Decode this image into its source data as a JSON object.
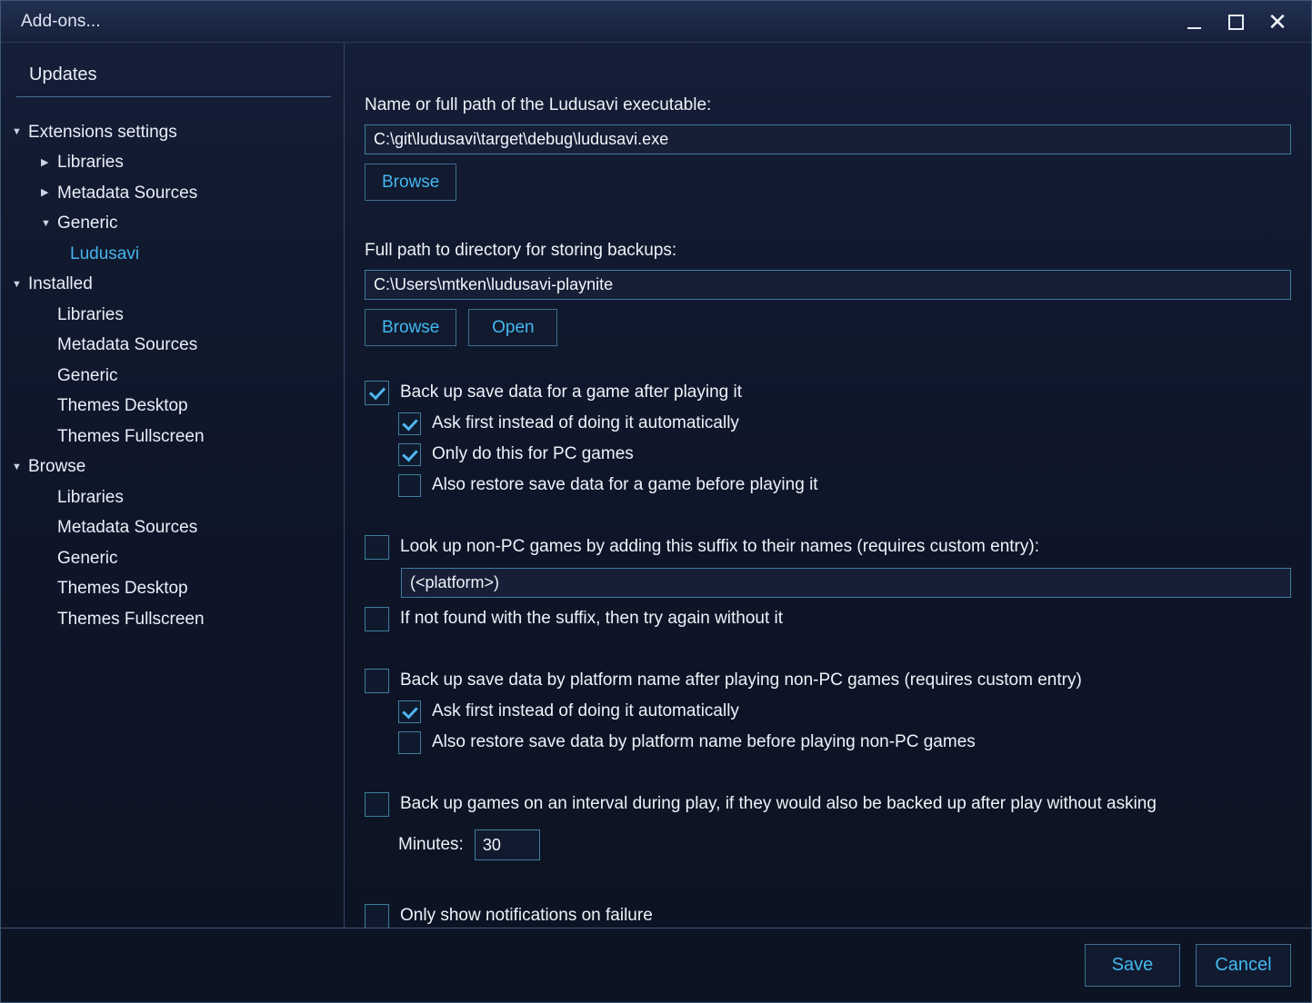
{
  "window": {
    "title": "Add-ons...",
    "minimize_icon": "minimize-icon",
    "maximize_icon": "maximize-icon",
    "close_icon": "close-icon"
  },
  "sidebar": {
    "updates_label": "Updates",
    "tree": [
      {
        "label": "Extensions settings",
        "level": 0,
        "marker": "▼",
        "selected": false
      },
      {
        "label": "Libraries",
        "level": 1,
        "marker": "▶",
        "selected": false
      },
      {
        "label": "Metadata Sources",
        "level": 1,
        "marker": "▶",
        "selected": false
      },
      {
        "label": "Generic",
        "level": 1,
        "marker": "▼",
        "selected": false
      },
      {
        "label": "Ludusavi",
        "level": 2,
        "marker": "",
        "selected": true
      },
      {
        "label": "Installed",
        "level": 0,
        "marker": "▼",
        "selected": false
      },
      {
        "label": "Libraries",
        "level": 1,
        "marker": "",
        "selected": false
      },
      {
        "label": "Metadata Sources",
        "level": 1,
        "marker": "",
        "selected": false
      },
      {
        "label": "Generic",
        "level": 1,
        "marker": "",
        "selected": false
      },
      {
        "label": "Themes Desktop",
        "level": 1,
        "marker": "",
        "selected": false
      },
      {
        "label": "Themes Fullscreen",
        "level": 1,
        "marker": "",
        "selected": false
      },
      {
        "label": "Browse",
        "level": 0,
        "marker": "▼",
        "selected": false
      },
      {
        "label": "Libraries",
        "level": 1,
        "marker": "",
        "selected": false
      },
      {
        "label": "Metadata Sources",
        "level": 1,
        "marker": "",
        "selected": false
      },
      {
        "label": "Generic",
        "level": 1,
        "marker": "",
        "selected": false
      },
      {
        "label": "Themes Desktop",
        "level": 1,
        "marker": "",
        "selected": false
      },
      {
        "label": "Themes Fullscreen",
        "level": 1,
        "marker": "",
        "selected": false
      }
    ]
  },
  "main": {
    "executable": {
      "label": "Name or full path of the Ludusavi executable:",
      "value": "C:\\git\\ludusavi\\target\\debug\\ludusavi.exe",
      "browse_label": "Browse"
    },
    "backup_dir": {
      "label": "Full path to directory for storing backups:",
      "value": "C:\\Users\\mtken\\ludusavi-playnite",
      "browse_label": "Browse",
      "open_label": "Open"
    },
    "backup_group": {
      "backup_after_play": {
        "label": "Back up save data for a game after playing it",
        "checked": true
      },
      "ask_first": {
        "label": "Ask first instead of doing it automatically",
        "checked": true
      },
      "only_pc": {
        "label": "Only do this for PC games",
        "checked": true
      },
      "restore_before_play": {
        "label": "Also restore save data for a game before playing it",
        "checked": false
      }
    },
    "suffix_group": {
      "lookup_suffix": {
        "label": "Look up non-PC games by adding this suffix to their names (requires custom entry):",
        "checked": false
      },
      "suffix_value": "(<platform>)",
      "retry_without_suffix": {
        "label": "If not found with the suffix, then try again without it",
        "checked": false
      }
    },
    "platform_group": {
      "backup_by_platform": {
        "label": "Back up save data by platform name after playing non-PC games (requires custom entry)",
        "checked": false
      },
      "ask_first": {
        "label": "Ask first instead of doing it automatically",
        "checked": true
      },
      "restore_by_platform": {
        "label": "Also restore save data by platform name before playing non-PC games",
        "checked": false
      }
    },
    "interval_group": {
      "backup_interval": {
        "label": "Back up games on an interval during play, if they would also be backed up after play without asking",
        "checked": false
      },
      "minutes_label": "Minutes:",
      "minutes_value": "30"
    },
    "notifications": {
      "label": "Only show notifications on failure",
      "checked": false
    }
  },
  "footer": {
    "save_label": "Save",
    "cancel_label": "Cancel"
  },
  "colors": {
    "accent": "#43b7f0",
    "selected_item": "#46b4ec",
    "border": "#3f7d9e",
    "text": "#eef2f8",
    "background": "#0e1528"
  }
}
